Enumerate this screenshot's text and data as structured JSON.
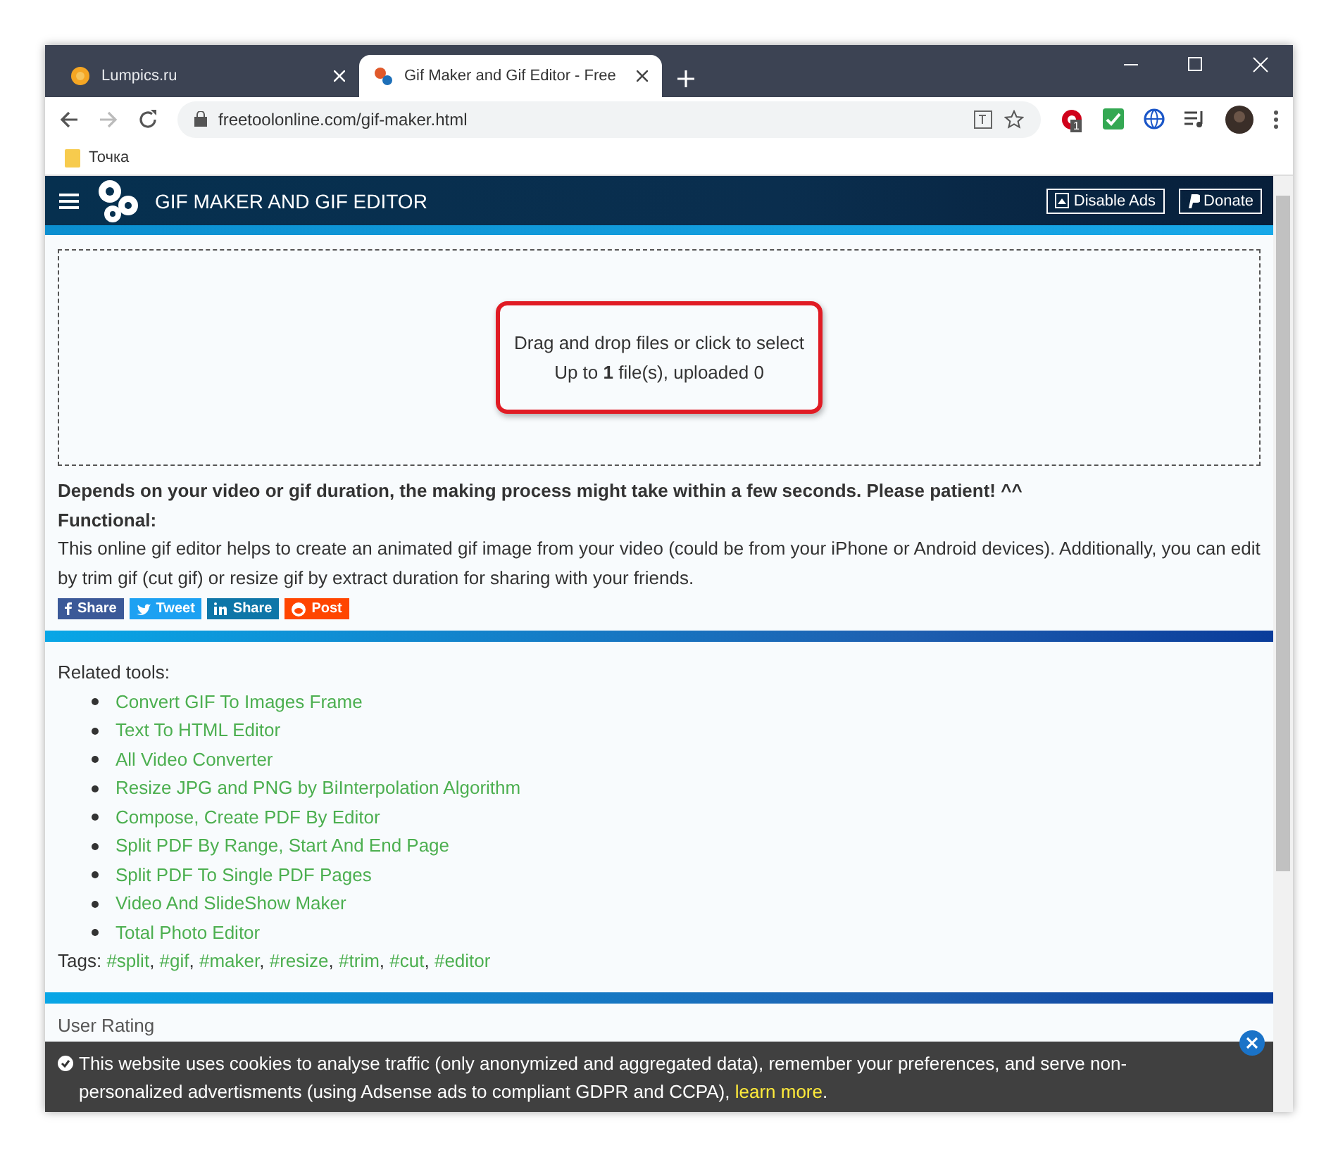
{
  "browser": {
    "tabs": [
      {
        "title": "Lumpics.ru",
        "selected": false
      },
      {
        "title": "Gif Maker and Gif Editor - Free",
        "selected": true
      }
    ],
    "address": "freetoolonline.com/gif-maker.html",
    "extension_badge": "1",
    "bookmarks": [
      "Точка"
    ]
  },
  "header": {
    "title": "GIF MAKER AND GIF EDITOR",
    "buttons": [
      {
        "label": "Disable Ads",
        "kind": "ads"
      },
      {
        "label": "Donate",
        "kind": "paypal"
      }
    ]
  },
  "dropzone": {
    "lines": [
      "Drag and drop files or click to select",
      "Up to **1** file(s), uploaded 0"
    ]
  },
  "notice": "Depends on your video or gif duration, the making process might take within a few seconds. Please patient! ^^",
  "functional_label": "Functional:",
  "description": "This online gif editor helps to create an animated gif image from your video (could be from your iPhone or Android devices). Additionally, you can edit by trim gif (cut gif) or resize gif by extract duration for sharing with your friends.",
  "share_buttons": [
    {
      "label": "Share",
      "kind": "facebook",
      "color": "#3b5998"
    },
    {
      "label": "Tweet",
      "kind": "twitter",
      "color": "#1da1f2"
    },
    {
      "label": "Share",
      "kind": "linkedin",
      "color": "#0e76a8"
    },
    {
      "label": "Post",
      "kind": "reddit",
      "color": "#ff4500"
    }
  ],
  "related": {
    "title": "Related tools:",
    "links": [
      "Convert GIF To Images Frame",
      "Text To HTML Editor",
      "All Video Converter",
      "Resize JPG and PNG by BiInterpolation Algorithm",
      "Compose, Create PDF By Editor",
      "Split PDF By Range, Start And End Page",
      "Split PDF To Single PDF Pages",
      "Video And SlideShow Maker",
      "Total Photo Editor"
    ]
  },
  "tags": {
    "label": "Tags:",
    "separator": ",",
    "items": [
      "#split",
      "#gif",
      "#maker",
      "#resize",
      "#trim",
      "#cut",
      "#editor"
    ]
  },
  "rating_title": "User Rating",
  "cookie": {
    "text": "This website uses cookies to analyse traffic (only anonymized and aggregated data), remember your preferences, and serve non-personalized advertisments (using Adsense ads to compliant GDPR and CCPA),",
    "link": "learn more",
    "end": "."
  }
}
